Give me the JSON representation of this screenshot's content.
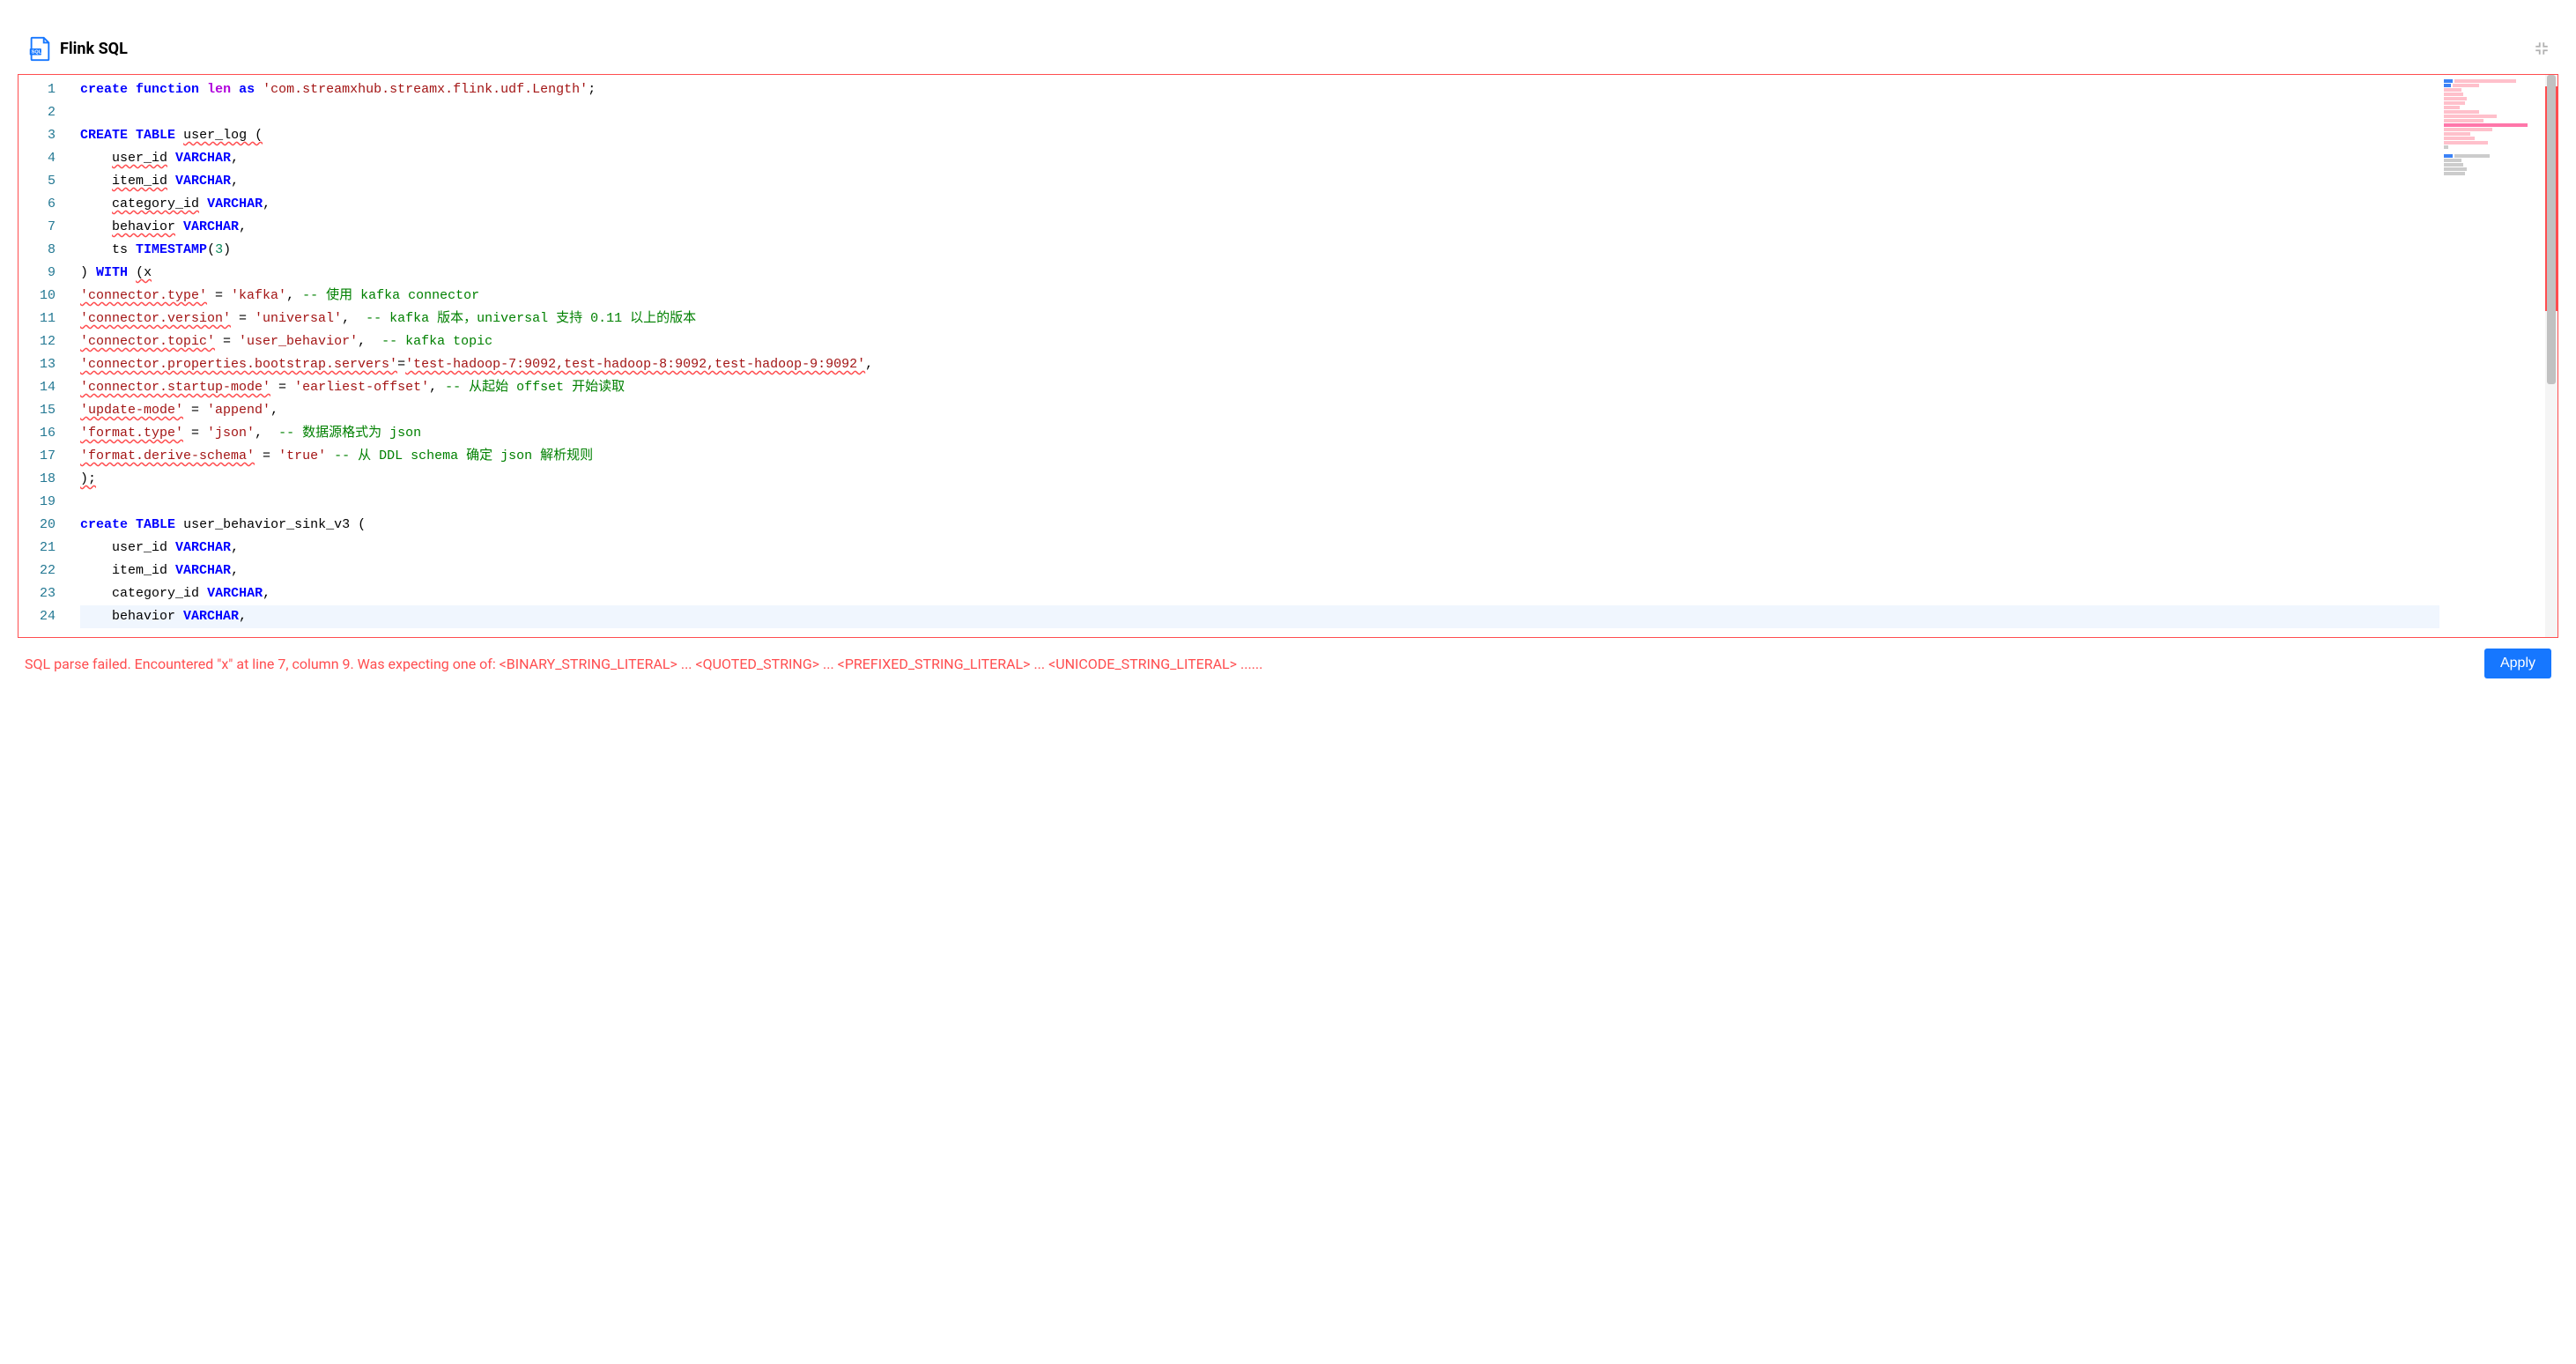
{
  "header": {
    "title": "Flink SQL"
  },
  "editor": {
    "line_numbers": [
      "1",
      "2",
      "3",
      "4",
      "5",
      "6",
      "7",
      "8",
      "9",
      "10",
      "11",
      "12",
      "13",
      "14",
      "15",
      "16",
      "17",
      "18",
      "19",
      "20",
      "21",
      "22",
      "23",
      "24"
    ],
    "lines": {
      "l1_kw1": "create",
      "l1_kw2": "function",
      "l1_name": "len",
      "l1_as": "as",
      "l1_str": "'com.streamxhub.streamx.flink.udf.Length'",
      "l1_semi": ";",
      "l3_kw1": "CREATE",
      "l3_kw2": "TABLE",
      "l3_name": "user_log (",
      "l4_col": "user_id",
      "l4_type": "VARCHAR",
      "l5_col": "item_id",
      "l5_type": "VARCHAR",
      "l6_col": "category_id",
      "l6_type": "VARCHAR",
      "l7_col": "behavior",
      "l7_type": "VARCHAR",
      "l8_col": "ts",
      "l8_type": "TIMESTAMP",
      "l8_arg": "3",
      "l9_close": ")",
      "l9_with": "WITH",
      "l9_open": "(x",
      "l10_key": "'connector.type'",
      "l10_eq": " = ",
      "l10_val": "'kafka'",
      "l10_cmt": "-- 使用 kafka connector",
      "l11_key": "'connector.version'",
      "l11_eq": " = ",
      "l11_val": "'universal'",
      "l11_cmt": "-- kafka 版本，universal 支持 0.11 以上的版本",
      "l12_key": "'connector.topic'",
      "l12_eq": " = ",
      "l12_val": "'user_behavior'",
      "l12_cmt": "-- kafka topic",
      "l13_key": "'connector.properties.bootstrap.servers'",
      "l13_eq": "=",
      "l13_val": "'test-hadoop-7:9092,test-hadoop-8:9092,test-hadoop-9:9092'",
      "l14_key": "'connector.startup-mode'",
      "l14_eq": " = ",
      "l14_val": "'earliest-offset'",
      "l14_cmt": "-- 从起始 offset 开始读取",
      "l15_key": "'update-mode'",
      "l15_eq": " = ",
      "l15_val": "'append'",
      "l16_key": "'format.type'",
      "l16_eq": " = ",
      "l16_val": "'json'",
      "l16_cmt": "-- 数据源格式为 json",
      "l17_key": "'format.derive-schema'",
      "l17_eq": " = ",
      "l17_val": "'true'",
      "l17_cmt": "-- 从 DDL schema 确定 json 解析规则",
      "l18_close": ");",
      "l20_kw1": "create",
      "l20_kw2": "TABLE",
      "l20_name": "user_behavior_sink_v3 (",
      "l21_col": "user_id",
      "l21_type": "VARCHAR",
      "l22_col": "item_id",
      "l22_type": "VARCHAR",
      "l23_col": "category_id",
      "l23_type": "VARCHAR",
      "l24_col": "behavior",
      "l24_type": "VARCHAR"
    }
  },
  "footer": {
    "error_message": "SQL parse failed. Encountered \"x\" at line 7, column 9. Was expecting one of: <BINARY_STRING_LITERAL> ... <QUOTED_STRING> ... <PREFIXED_STRING_LITERAL> ... <UNICODE_STRING_LITERAL> ......",
    "apply_label": "Apply"
  }
}
